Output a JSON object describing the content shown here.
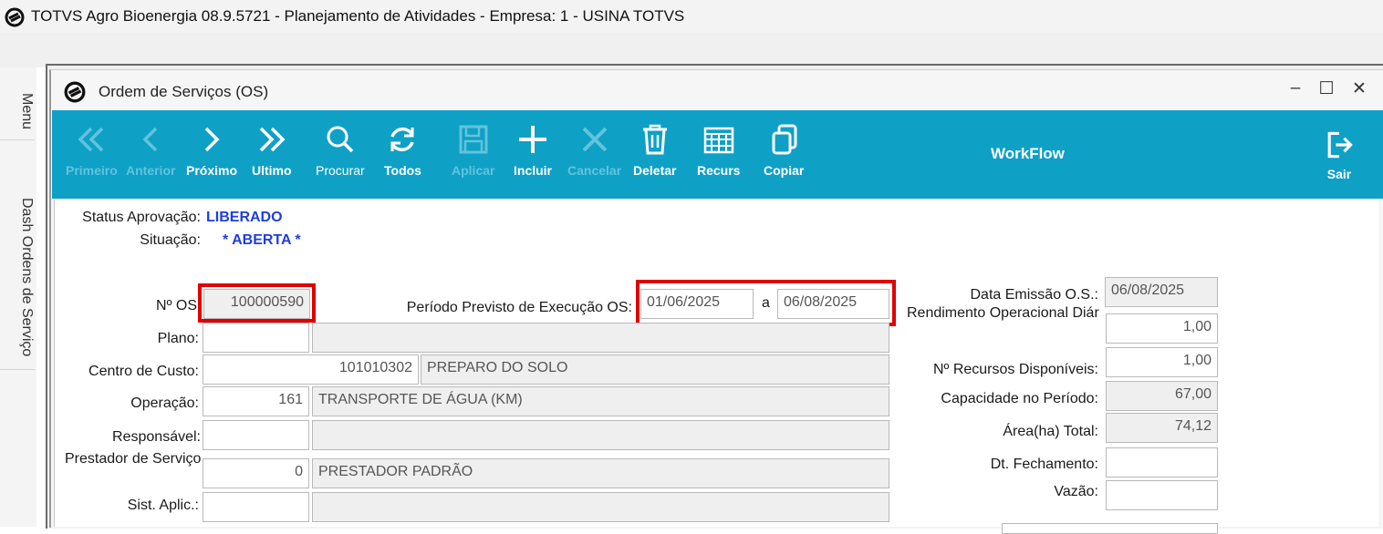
{
  "app": {
    "title": "TOTVS Agro Bioenergia 08.9.5721 - Planejamento de Atividades  - Empresa: 1 - USINA TOTVS"
  },
  "side_tabs": [
    "Menu",
    "Dash Ordens de Serviço"
  ],
  "window": {
    "title": "Ordem de Serviços (OS)",
    "controls": {
      "minimize": "–",
      "maximize": "☐",
      "close": "✕"
    }
  },
  "toolbar": {
    "primeiro": "Primeiro",
    "anterior": "Anterior",
    "proximo": "Próximo",
    "ultimo": "Ultimo",
    "procurar": "Procurar",
    "todos": "Todos",
    "aplicar": "Aplicar",
    "incluir": "Incluir",
    "cancelar": "Cancelar",
    "deletar": "Deletar",
    "recurs": "Recurs",
    "copiar": "Copiar",
    "workflow": "WorkFlow",
    "sair": "Sair"
  },
  "colors": {
    "toolbar_bg": "#0fa0c6",
    "status_blue": "#1f3de0",
    "highlight_red": "#e00000"
  },
  "form": {
    "status_aprovacao_label": "Status Aprovação:",
    "status_aprovacao_value": "LIBERADO",
    "situacao_label": "Situação:",
    "situacao_value": "* ABERTA *",
    "nos_label": "Nº OS",
    "nos_value": "100000590",
    "periodo_label": "Período Previsto de Execução OS:",
    "periodo_inicio": "01/06/2025",
    "periodo_sep": "a",
    "periodo_fim": "06/08/2025",
    "plano_label": "Plano:",
    "plano_code": "",
    "plano_desc": "",
    "centro_label": "Centro de Custo:",
    "centro_code": "101010302",
    "centro_desc": "PREPARO DO SOLO",
    "operacao_label": "Operação:",
    "operacao_code": "161",
    "operacao_desc": "TRANSPORTE DE ÁGUA (KM)",
    "responsavel_label": "Responsável:",
    "responsavel_code": "",
    "responsavel_desc": "",
    "prestador_label": "Prestador de Serviço",
    "prestador_code": "0",
    "prestador_desc": "PRESTADOR PADRÃO",
    "sist_label": "Sist. Aplic.:",
    "sist_code": "",
    "sist_desc": "",
    "data_emissao_label": "Data Emissão O.S.:",
    "data_emissao_value": "06/08/2025",
    "rendimento_label": "Rendimento Operacional Diár",
    "rendimento_value": "1,00",
    "recursos_label": "Nº Recursos Disponíveis:",
    "recursos_value": "1,00",
    "capacidade_label": "Capacidade no Período:",
    "capacidade_value": "67,00",
    "area_label": "Área(ha) Total:",
    "area_value": "74,12",
    "fechamento_label": "Dt. Fechamento:",
    "fechamento_value": "",
    "vazao_label": "Vazão:",
    "vazao_value": ""
  }
}
